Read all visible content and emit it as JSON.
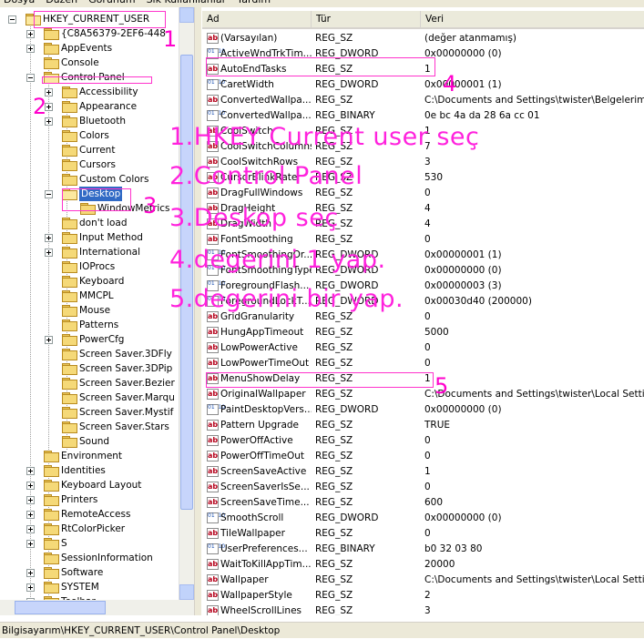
{
  "menu": [
    "Dosya",
    "Düzen",
    "Görünüm",
    "Sık Kullanılanlar",
    "Yardım"
  ],
  "tree": {
    "items": [
      {
        "label": "HKEY_CURRENT_USER",
        "expander": "minus",
        "open": true
      },
      {
        "label": "{C8A56379-2EF6-448",
        "expander": "plus"
      },
      {
        "label": "AppEvents",
        "expander": "plus"
      },
      {
        "label": "Console",
        "expander": "none"
      },
      {
        "label": "Control Panel",
        "expander": "minus",
        "open": true
      },
      {
        "label": "Accessibility",
        "expander": "plus"
      },
      {
        "label": "Appearance",
        "expander": "plus"
      },
      {
        "label": "Bluetooth",
        "expander": "plus"
      },
      {
        "label": "Colors",
        "expander": "none"
      },
      {
        "label": "Current",
        "expander": "none"
      },
      {
        "label": "Cursors",
        "expander": "none"
      },
      {
        "label": "Custom Colors",
        "expander": "none"
      },
      {
        "label": "Desktop",
        "expander": "minus",
        "open": true,
        "selected": true
      },
      {
        "label": "WindowMetrics",
        "expander": "none"
      },
      {
        "label": "don't load",
        "expander": "none"
      },
      {
        "label": "Input Method",
        "expander": "plus"
      },
      {
        "label": "International",
        "expander": "plus"
      },
      {
        "label": "IOProcs",
        "expander": "none"
      },
      {
        "label": "Keyboard",
        "expander": "none"
      },
      {
        "label": "MMCPL",
        "expander": "none"
      },
      {
        "label": "Mouse",
        "expander": "none"
      },
      {
        "label": "Patterns",
        "expander": "none"
      },
      {
        "label": "PowerCfg",
        "expander": "plus"
      },
      {
        "label": "Screen Saver.3DFly",
        "expander": "none"
      },
      {
        "label": "Screen Saver.3DPip",
        "expander": "none"
      },
      {
        "label": "Screen Saver.Bezier",
        "expander": "none"
      },
      {
        "label": "Screen Saver.Marqu",
        "expander": "none"
      },
      {
        "label": "Screen Saver.Mystif",
        "expander": "none"
      },
      {
        "label": "Screen Saver.Stars",
        "expander": "none"
      },
      {
        "label": "Sound",
        "expander": "none"
      },
      {
        "label": "Environment",
        "expander": "none"
      },
      {
        "label": "Identities",
        "expander": "plus"
      },
      {
        "label": "Keyboard Layout",
        "expander": "plus"
      },
      {
        "label": "Printers",
        "expander": "plus"
      },
      {
        "label": "RemoteAccess",
        "expander": "plus"
      },
      {
        "label": "RtColorPicker",
        "expander": "plus"
      },
      {
        "label": "S",
        "expander": "plus"
      },
      {
        "label": "SessionInformation",
        "expander": "none"
      },
      {
        "label": "Software",
        "expander": "plus"
      },
      {
        "label": "SYSTEM",
        "expander": "plus"
      },
      {
        "label": "Toolbar",
        "expander": "plus"
      }
    ]
  },
  "list": {
    "columns": [
      "Ad",
      "Tür",
      "Veri"
    ],
    "rows": [
      {
        "name": "(Varsayılan)",
        "type": "REG_SZ",
        "data": "(değer atanmamış)",
        "icon": "string-value-icon"
      },
      {
        "name": "ActiveWndTrkTim...",
        "type": "REG_DWORD",
        "data": "0x00000000 (0)",
        "icon": "binary-value-icon"
      },
      {
        "name": "AutoEndTasks",
        "type": "REG_SZ",
        "data": "1",
        "icon": "string-value-icon"
      },
      {
        "name": "CaretWidth",
        "type": "REG_DWORD",
        "data": "0x00000001 (1)",
        "icon": "binary-value-icon"
      },
      {
        "name": "ConvertedWallpa...",
        "type": "REG_SZ",
        "data": "C:\\Documents and Settings\\twister\\Belgelerim\\pro",
        "icon": "string-value-icon"
      },
      {
        "name": "ConvertedWallpa...",
        "type": "REG_BINARY",
        "data": "0e bc 4a da 28 6a cc 01",
        "icon": "binary-value-icon"
      },
      {
        "name": "CoolSwitch",
        "type": "REG_SZ",
        "data": "1",
        "icon": "string-value-icon"
      },
      {
        "name": "CoolSwitchColumns",
        "type": "REG_SZ",
        "data": "7",
        "icon": "string-value-icon"
      },
      {
        "name": "CoolSwitchRows",
        "type": "REG_SZ",
        "data": "3",
        "icon": "string-value-icon"
      },
      {
        "name": "CursorBlinkRate",
        "type": "REG_SZ",
        "data": "530",
        "icon": "string-value-icon"
      },
      {
        "name": "DragFullWindows",
        "type": "REG_SZ",
        "data": "0",
        "icon": "string-value-icon"
      },
      {
        "name": "DragHeight",
        "type": "REG_SZ",
        "data": "4",
        "icon": "string-value-icon"
      },
      {
        "name": "DragWidth",
        "type": "REG_SZ",
        "data": "4",
        "icon": "string-value-icon"
      },
      {
        "name": "FontSmoothing",
        "type": "REG_SZ",
        "data": "0",
        "icon": "string-value-icon"
      },
      {
        "name": "FontSmoothingOr...",
        "type": "REG_DWORD",
        "data": "0x00000001 (1)",
        "icon": "binary-value-icon"
      },
      {
        "name": "FontSmoothingType",
        "type": "REG_DWORD",
        "data": "0x00000000 (0)",
        "icon": "binary-value-icon"
      },
      {
        "name": "ForegroundFlash...",
        "type": "REG_DWORD",
        "data": "0x00000003 (3)",
        "icon": "binary-value-icon"
      },
      {
        "name": "ForegroundLockT...",
        "type": "REG_DWORD",
        "data": "0x00030d40 (200000)",
        "icon": "binary-value-icon"
      },
      {
        "name": "GridGranularity",
        "type": "REG_SZ",
        "data": "0",
        "icon": "string-value-icon"
      },
      {
        "name": "HungAppTimeout",
        "type": "REG_SZ",
        "data": "5000",
        "icon": "string-value-icon"
      },
      {
        "name": "LowPowerActive",
        "type": "REG_SZ",
        "data": "0",
        "icon": "string-value-icon"
      },
      {
        "name": "LowPowerTimeOut",
        "type": "REG_SZ",
        "data": "0",
        "icon": "string-value-icon"
      },
      {
        "name": "MenuShowDelay",
        "type": "REG_SZ",
        "data": "1",
        "icon": "string-value-icon"
      },
      {
        "name": "OriginalWallpaper",
        "type": "REG_SZ",
        "data": "C:\\Documents and Settings\\twister\\Local Settings\\",
        "icon": "string-value-icon"
      },
      {
        "name": "PaintDesktopVers...",
        "type": "REG_DWORD",
        "data": "0x00000000 (0)",
        "icon": "binary-value-icon"
      },
      {
        "name": "Pattern Upgrade",
        "type": "REG_SZ",
        "data": "TRUE",
        "icon": "string-value-icon"
      },
      {
        "name": "PowerOffActive",
        "type": "REG_SZ",
        "data": "0",
        "icon": "string-value-icon"
      },
      {
        "name": "PowerOffTimeOut",
        "type": "REG_SZ",
        "data": "0",
        "icon": "string-value-icon"
      },
      {
        "name": "ScreenSaveActive",
        "type": "REG_SZ",
        "data": "1",
        "icon": "string-value-icon"
      },
      {
        "name": "ScreenSaverIsSe...",
        "type": "REG_SZ",
        "data": "0",
        "icon": "string-value-icon"
      },
      {
        "name": "ScreenSaveTime...",
        "type": "REG_SZ",
        "data": "600",
        "icon": "string-value-icon"
      },
      {
        "name": "SmoothScroll",
        "type": "REG_DWORD",
        "data": "0x00000000 (0)",
        "icon": "binary-value-icon"
      },
      {
        "name": "TileWallpaper",
        "type": "REG_SZ",
        "data": "0",
        "icon": "string-value-icon"
      },
      {
        "name": "UserPreferences...",
        "type": "REG_BINARY",
        "data": "b0 32 03 80",
        "icon": "binary-value-icon"
      },
      {
        "name": "WaitToKillAppTim...",
        "type": "REG_SZ",
        "data": "20000",
        "icon": "string-value-icon"
      },
      {
        "name": "Wallpaper",
        "type": "REG_SZ",
        "data": "C:\\Documents and Settings\\twister\\Local Settings\\",
        "icon": "string-value-icon"
      },
      {
        "name": "WallpaperStyle",
        "type": "REG_SZ",
        "data": "2",
        "icon": "string-value-icon"
      },
      {
        "name": "WheelScrollLines",
        "type": "REG_SZ",
        "data": "3",
        "icon": "string-value-icon"
      }
    ]
  },
  "status": "Bilgisayarım\\HKEY_CURRENT_USER\\Control Panel\\Desktop",
  "annotations": {
    "markers": [
      "1",
      "2",
      "3",
      "4",
      "5"
    ],
    "instructions": [
      "1.HKEY Current user seç",
      "2.Control Panel",
      "3.Deskop seç",
      "4.degerini 1 yap.",
      "5.degerini bir yap."
    ],
    "color": "#ff22dd"
  }
}
